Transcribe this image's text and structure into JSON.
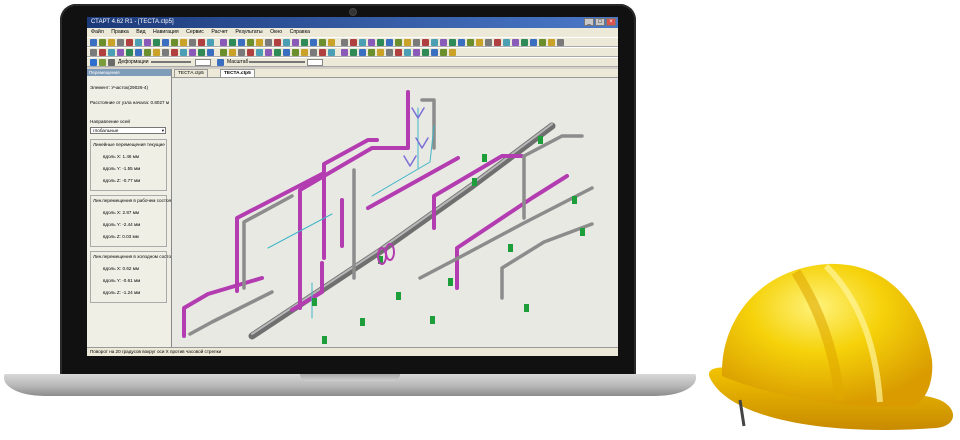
{
  "window": {
    "title": "СТАРТ 4.62 R1 - [ТЕСТА.ctp5]"
  },
  "menu": [
    "Файл",
    "Правка",
    "Вид",
    "Навигация",
    "Сервис",
    "Расчет",
    "Результаты",
    "Окно",
    "Справка"
  ],
  "toolbar": {
    "deformation_label": "Деформации",
    "scale_label": "Масштаб"
  },
  "panel": {
    "header": "Перемещения",
    "element": "Элемент: Участок(29026-4)",
    "distance": "Расстояние от узла начала:  0.8027 м",
    "direction_label": "Направление осей",
    "direction_value": "глобальные",
    "group1": {
      "title": "Линейные перемещения текущие",
      "x": "вдоль X: 1.46 мм",
      "y": "вдоль Y: -1.55 мм",
      "z": "вдоль Z: -0.77 мм"
    },
    "group2": {
      "title": "Лин.перемещения в рабочем состоя",
      "x": "вдоль X: 2.87 мм",
      "y": "вдоль Y: -2.44 мм",
      "z": "вдоль Z: 0.03 мм"
    },
    "group3": {
      "title": "Лин.перемещения в холодном состо",
      "x": "вдоль X: 0.62 мм",
      "y": "вдоль Y: -0.61 мм",
      "z": "вдоль Z: -1.24 мм"
    }
  },
  "tabs": [
    {
      "label": "ТЕСТА.ctp5"
    },
    {
      "label": "ТЕСТА.ctp5"
    }
  ],
  "status": "Поворот на 20 градусов вокруг оси X против часовой стрелки",
  "colors": {
    "pipe_pink": "#b23cb0",
    "pipe_gray": "#8c8c8c",
    "support_green": "#1e9e3a",
    "helmet_yellow": "#f5d20a"
  }
}
